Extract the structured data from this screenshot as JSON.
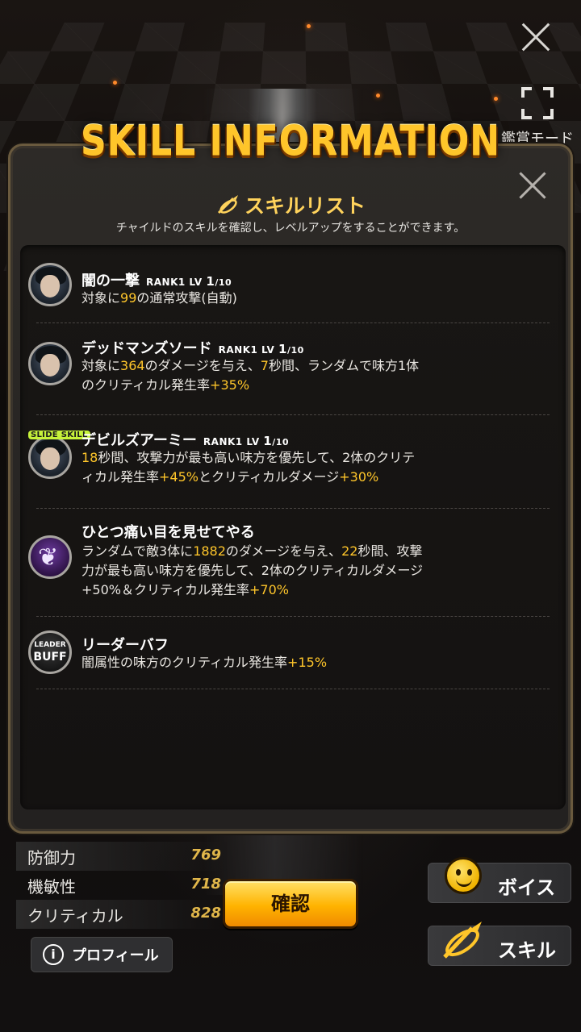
{
  "header": {
    "view_mode_label": "鑑賞モード",
    "title": "SKILL INFORMATION"
  },
  "panel": {
    "list_title": "スキルリスト",
    "list_desc": "チャイルドのスキルを確認し、レベルアップをすることができます。"
  },
  "skills": [
    {
      "name": "闇の一撃",
      "rank": "RANK1",
      "lv": "LV",
      "lv_cur": "1",
      "lv_max": "/10",
      "desc_parts": [
        "対象に",
        "99",
        "の通常攻撃(自動)"
      ]
    },
    {
      "name": "デッドマンズソード",
      "rank": "RANK1",
      "lv": "LV",
      "lv_cur": "1",
      "lv_max": "/10",
      "desc_parts": [
        "対象に",
        "364",
        "のダメージを与え、",
        "7",
        "秒間、ランダムで味方1体",
        "のクリティカル発生率",
        "+35%"
      ]
    },
    {
      "name": "デビルズアーミー",
      "badge": "SLIDE SKILL",
      "rank": "RANK1",
      "lv": "LV",
      "lv_cur": "1",
      "lv_max": "/10",
      "desc_parts": [
        "18",
        "秒間、攻撃力が最も高い味方を優先して、2体のクリテ",
        "ィカル発生率",
        "+45%",
        "とクリティカルダメージ",
        "+30%"
      ]
    },
    {
      "name": "ひとつ痛い目を見せてやる",
      "desc_parts": [
        "ランダムで敵3体に",
        "1882",
        "のダメージを与え、",
        "22",
        "秒間、攻撃",
        "力が最も高い味方を優先して、2体のクリティカルダメージ",
        "+50%＆クリティカル発生率",
        "+70%"
      ]
    },
    {
      "name": "リーダーバフ",
      "badge_top": "LEADER",
      "badge_bottom": "BUFF",
      "desc_parts": [
        "闇属性の味方のクリティカル発生率",
        "+15%"
      ]
    }
  ],
  "stats": [
    {
      "label": "防御力",
      "value": "769"
    },
    {
      "label": "機敏性",
      "value": "718"
    },
    {
      "label": "クリティカル",
      "value": "828"
    }
  ],
  "buttons": {
    "confirm": "確認",
    "profile": "プロフィール",
    "voice": "ボイス",
    "skill": "スキル"
  },
  "colors": {
    "accent": "#ffc62a",
    "panel_border": "#6a5a3e"
  }
}
